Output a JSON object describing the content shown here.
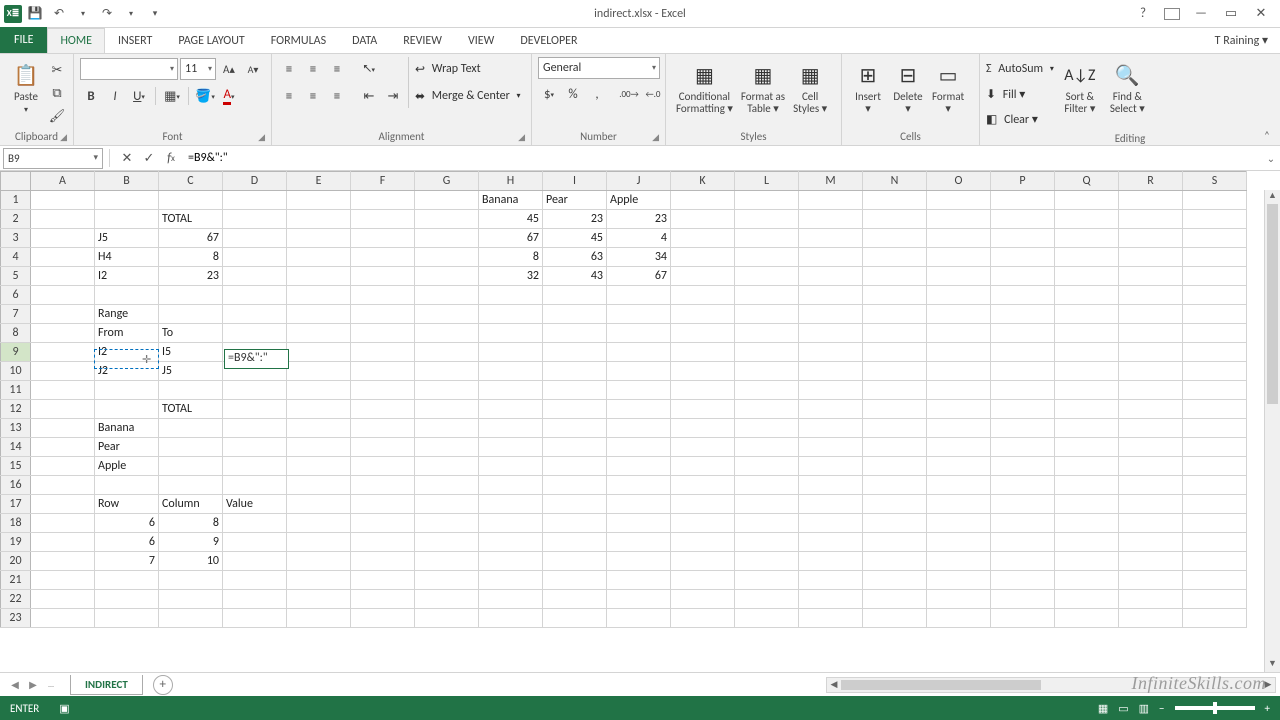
{
  "titlebar": {
    "title": "indirect.xlsx - Excel"
  },
  "tabs": {
    "file": "FILE",
    "list": [
      "HOME",
      "INSERT",
      "PAGE LAYOUT",
      "FORMULAS",
      "DATA",
      "REVIEW",
      "VIEW",
      "DEVELOPER"
    ],
    "user": "T Raining ▾"
  },
  "ribbon": {
    "clipboard": {
      "paste": "Paste",
      "label": "Clipboard"
    },
    "font": {
      "name": "",
      "size": "11",
      "label": "Font"
    },
    "alignment": {
      "wrap": "Wrap Text",
      "merge": "Merge & Center",
      "label": "Alignment"
    },
    "number": {
      "format": "General",
      "label": "Number"
    },
    "styles": {
      "cond": "Conditional\nFormatting ▾",
      "table": "Format as\nTable ▾",
      "cell": "Cell\nStyles ▾",
      "label": "Styles"
    },
    "cells": {
      "insert": "Insert\n▾",
      "delete": "Delete\n▾",
      "format": "Format\n▾",
      "label": "Cells"
    },
    "editing": {
      "sum": "AutoSum",
      "fill": "Fill ▾",
      "clear": "Clear ▾",
      "sort": "Sort &\nFilter ▾",
      "find": "Find &\nSelect ▾",
      "label": "Editing"
    }
  },
  "formula_bar": {
    "namebox": "B9",
    "formula": "=B9&\":\""
  },
  "grid": {
    "columns": [
      "A",
      "B",
      "C",
      "D",
      "E",
      "F",
      "G",
      "H",
      "I",
      "J",
      "K",
      "L",
      "M",
      "N",
      "O",
      "P",
      "Q",
      "R",
      "S"
    ],
    "rows": 23,
    "cells": {
      "H1": "Banana",
      "I1": "Pear",
      "J1": "Apple",
      "C2": "TOTAL",
      "H2": "45",
      "I2": "23",
      "J2": "23",
      "B3": "J5",
      "C3": "67",
      "H3": "67",
      "I3": "45",
      "J3": "4",
      "B4": "H4",
      "C4": "8",
      "H4": "8",
      "I4": "63",
      "J4": "34",
      "B5": "I2",
      "C5": "23",
      "H5": "32",
      "I5": "43",
      "J5": "67",
      "B7": "Range",
      "B8": "From",
      "C8": "To",
      "B9": "I2",
      "C9": "I5",
      "D9": "=B9&\":\"",
      "B10": "J2",
      "C10": "J5",
      "C12": "TOTAL",
      "B13": "Banana",
      "B14": "Pear",
      "B15": "Apple",
      "B17": "Row",
      "C17": "Column",
      "D17": "Value",
      "B18": "6",
      "C18": "8",
      "B19": "6",
      "C19": "9",
      "B20": "7",
      "C20": "10"
    },
    "numeric_cells": [
      "H2",
      "I2",
      "J2",
      "C3",
      "H3",
      "I3",
      "J3",
      "C4",
      "H4",
      "I4",
      "J4",
      "C5",
      "H5",
      "I5",
      "J5",
      "B18",
      "C18",
      "B19",
      "C19",
      "B20",
      "C20"
    ]
  },
  "sheet": {
    "active": "INDIRECT"
  },
  "status": {
    "mode": "ENTER"
  },
  "watermark": "InfiniteSkills.com"
}
